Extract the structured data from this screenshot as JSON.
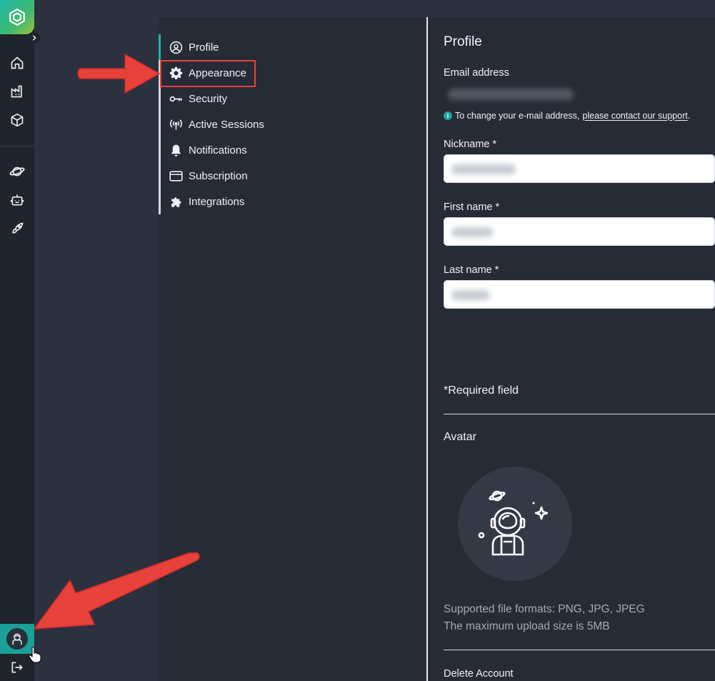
{
  "nav": {
    "items": [
      {
        "label": "Profile",
        "icon": "user-circle-icon",
        "active": true
      },
      {
        "label": "Appearance",
        "icon": "gear-icon"
      },
      {
        "label": "Security",
        "icon": "key-icon"
      },
      {
        "label": "Active Sessions",
        "icon": "broadcast-icon"
      },
      {
        "label": "Notifications",
        "icon": "bell-icon"
      },
      {
        "label": "Subscription",
        "icon": "credit-card-icon"
      },
      {
        "label": "Integrations",
        "icon": "puzzle-icon"
      }
    ]
  },
  "profile": {
    "title": "Profile",
    "email_label": "Email address",
    "email_hint": "To change your e-mail address,",
    "email_link": "please contact our support",
    "email_hint_end": ".",
    "nickname_label": "Nickname *",
    "first_name_label": "First name *",
    "last_name_label": "Last name *",
    "required_note": "*Required field",
    "avatar_title": "Avatar",
    "formats_note": "Supported file formats: PNG, JPG, JPEG",
    "size_note": "The maximum upload size is 5MB",
    "delete_title": "Delete Account"
  },
  "colors": {
    "accent": "#1fb3a8",
    "annotation_red": "#e8413c",
    "panel_bg": "#262b36",
    "rail_bg": "#1f242d"
  }
}
